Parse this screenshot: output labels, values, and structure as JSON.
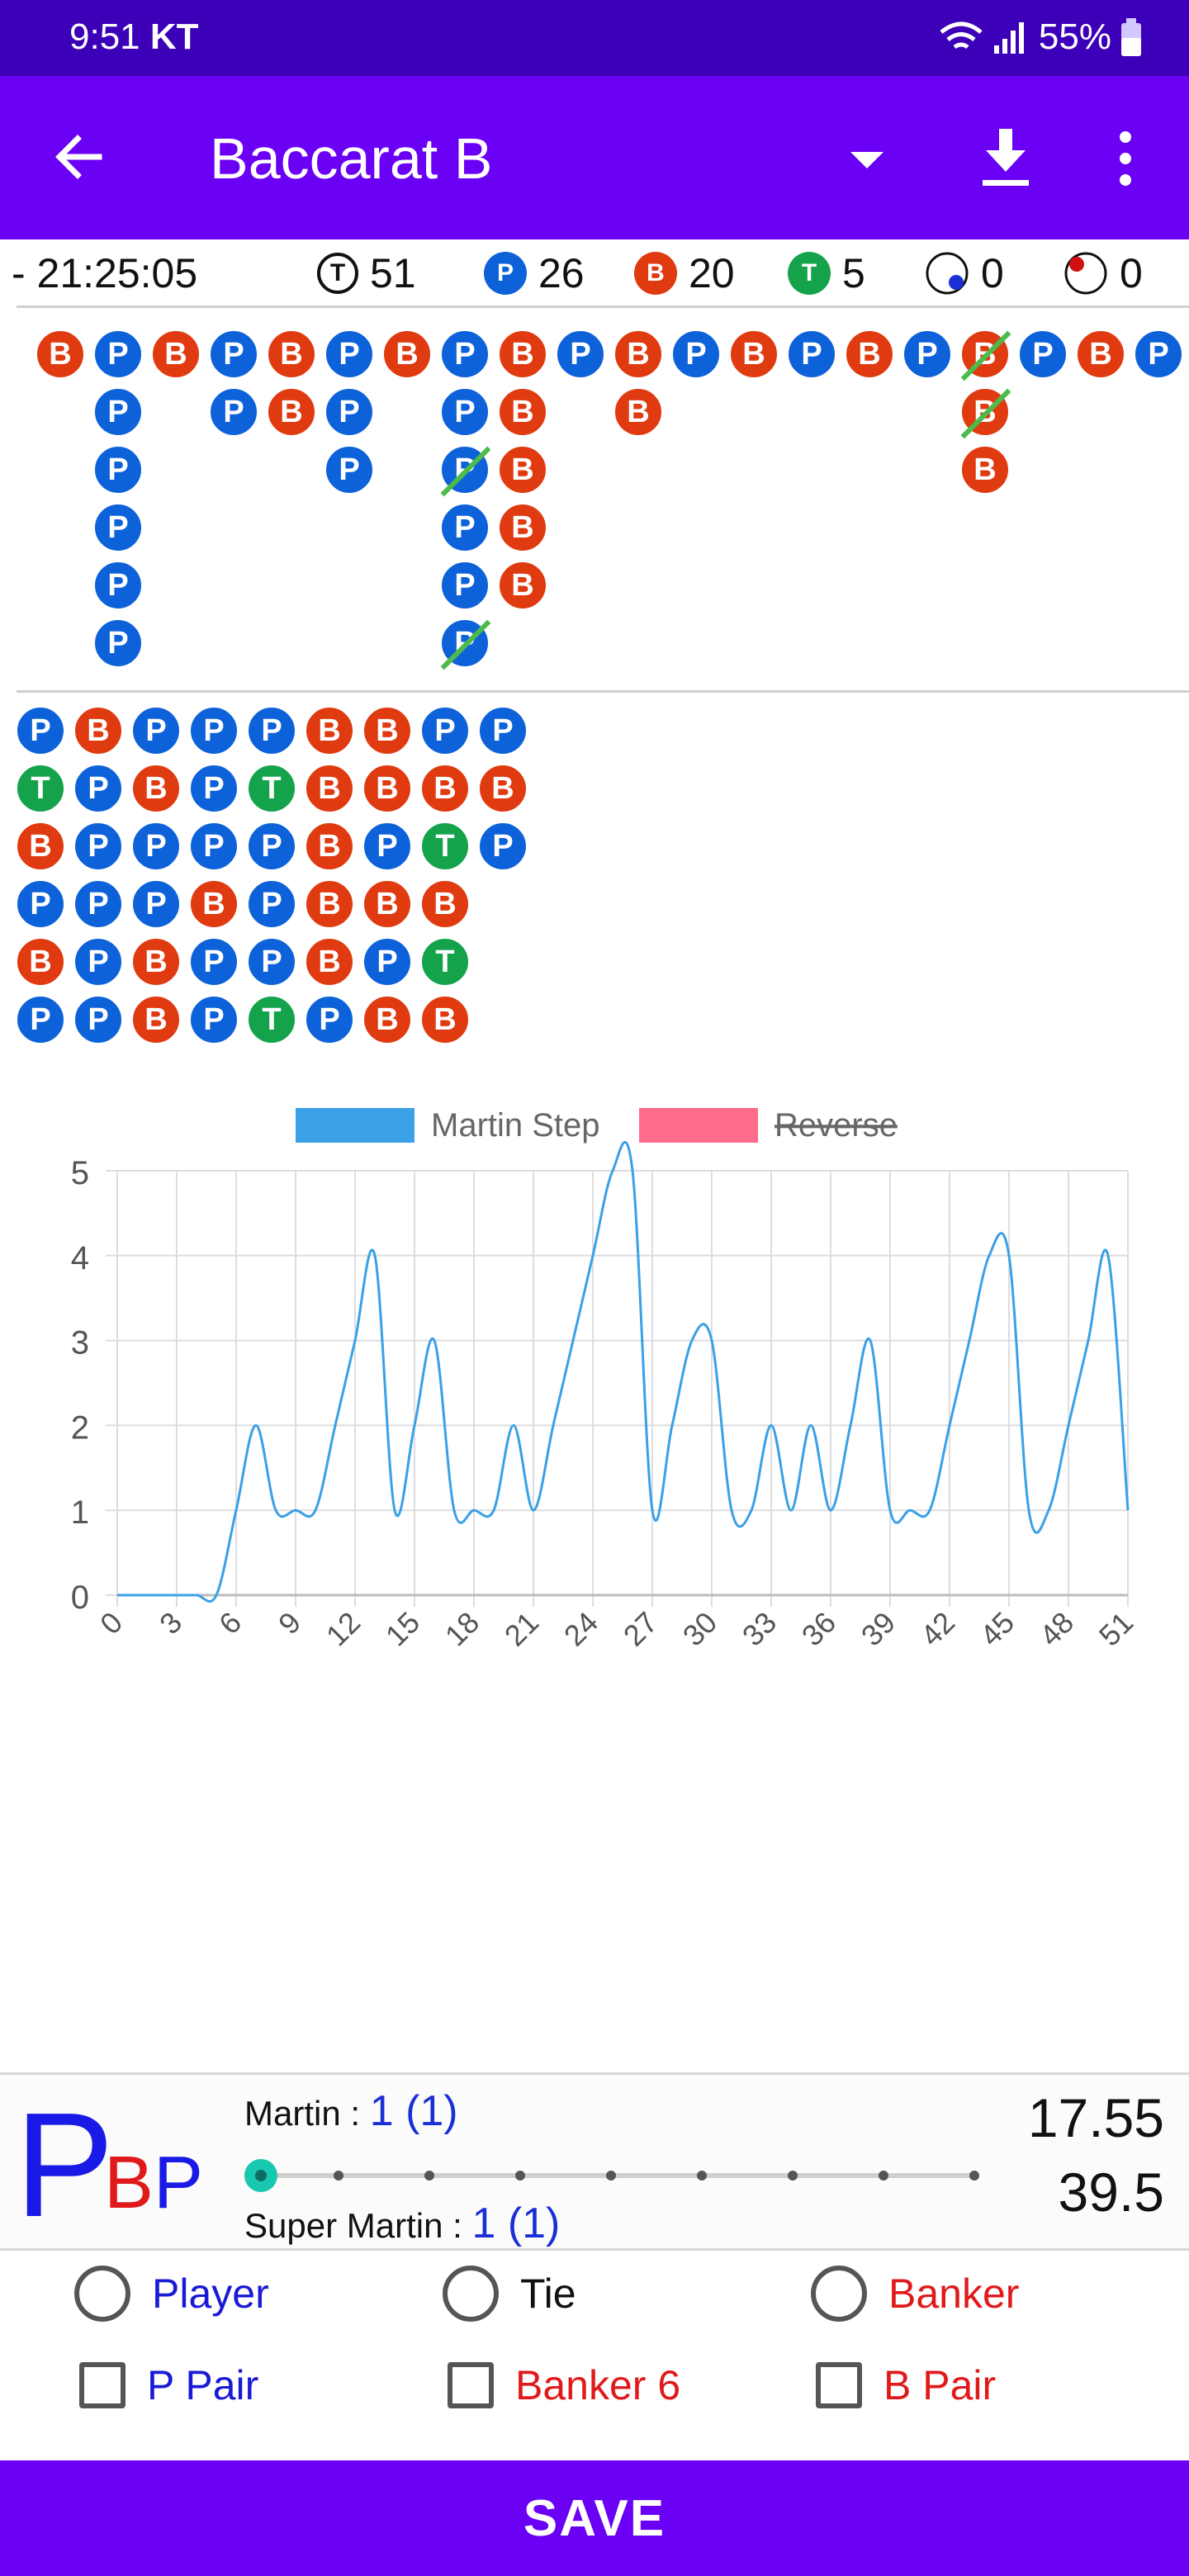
{
  "status": {
    "time": "9:51",
    "carrier": "KT",
    "battery": "55%"
  },
  "appbar": {
    "title": "Baccarat B"
  },
  "stats": {
    "timestamp": "- 21:25:05",
    "total_icon": "T",
    "total": "51",
    "player_icon": "P",
    "player": "26",
    "banker_icon": "B",
    "banker": "20",
    "tie_icon": "T",
    "tie": "5",
    "pair_player": "0",
    "pair_banker": "0"
  },
  "colors": {
    "player": "#0d62d9",
    "banker": "#e03a10",
    "tie": "#14a34a",
    "accent": "#6a00f4"
  },
  "big_road": {
    "columns": [
      [
        "B"
      ],
      [
        "P",
        "P",
        "P",
        "P",
        "P",
        "P"
      ],
      [
        "B"
      ],
      [
        "P",
        "P"
      ],
      [
        "B",
        "B"
      ],
      [
        "P",
        "P",
        "P"
      ],
      [
        "B"
      ],
      [
        "P",
        "P",
        "P",
        "P",
        "P",
        "P"
      ],
      [
        "B",
        "B",
        "B",
        "B",
        "B"
      ],
      [
        "P"
      ],
      [
        "B",
        "B"
      ],
      [
        "P"
      ],
      [
        "B"
      ],
      [
        "P"
      ],
      [
        "B"
      ],
      [
        "P"
      ],
      [
        "B",
        "B",
        "B"
      ],
      [
        "P"
      ],
      [
        "B"
      ],
      [
        "P"
      ]
    ],
    "ties": [
      [
        7,
        2
      ],
      [
        7,
        5
      ],
      [
        16,
        0
      ],
      [
        16,
        1
      ]
    ]
  },
  "bead_road": {
    "columns": [
      [
        "P",
        "T",
        "B",
        "P",
        "B",
        "P"
      ],
      [
        "B",
        "P",
        "P",
        "P",
        "P",
        "P"
      ],
      [
        "P",
        "B",
        "P",
        "P",
        "B",
        "B"
      ],
      [
        "P",
        "P",
        "P",
        "B",
        "P",
        "P"
      ],
      [
        "P",
        "T",
        "P",
        "P",
        "P",
        "T"
      ],
      [
        "B",
        "B",
        "B",
        "B",
        "B",
        "P"
      ],
      [
        "B",
        "B",
        "P",
        "B",
        "P",
        "B"
      ],
      [
        "P",
        "B",
        "T",
        "B",
        "T",
        "B"
      ],
      [
        "P",
        "B",
        "P"
      ]
    ]
  },
  "chart_data": {
    "type": "line",
    "legend": [
      "Martin Step",
      "Reverse"
    ],
    "legend_disabled": [
      "Reverse"
    ],
    "x_ticks": [
      "0",
      "3",
      "6",
      "9",
      "12",
      "15",
      "18",
      "21",
      "24",
      "27",
      "30",
      "33",
      "36",
      "39",
      "42",
      "45",
      "48",
      "51"
    ],
    "y_ticks": [
      "0",
      "1",
      "2",
      "3",
      "4",
      "5"
    ],
    "ylim": [
      0,
      5
    ],
    "xlim": [
      0,
      51
    ],
    "series": [
      {
        "name": "Martin Step",
        "color": "#3ba0e6",
        "values": [
          0,
          0,
          0,
          0,
          0,
          0,
          1,
          2,
          1,
          1,
          1,
          2,
          3,
          4,
          1,
          2,
          3,
          1,
          1,
          1,
          2,
          1,
          2,
          3,
          4,
          5,
          5,
          1,
          2,
          3,
          3,
          1,
          1,
          2,
          1,
          2,
          1,
          2,
          3,
          1,
          1,
          1,
          2,
          3,
          4,
          4,
          1,
          1,
          2,
          3,
          4,
          1
        ]
      }
    ]
  },
  "panel": {
    "big_p": "P",
    "big_b": "B",
    "big_p2": "P",
    "martin_label": "Martin :",
    "martin_value": "1 (1)",
    "super_label": "Super Martin :",
    "super_value": "1 (1)",
    "value1": "17.55",
    "value2": "39.5"
  },
  "options": {
    "player": "Player",
    "tie": "Tie",
    "banker": "Banker",
    "p_pair": "P Pair",
    "banker6": "Banker 6",
    "b_pair": "B Pair"
  },
  "save_label": "SAVE"
}
